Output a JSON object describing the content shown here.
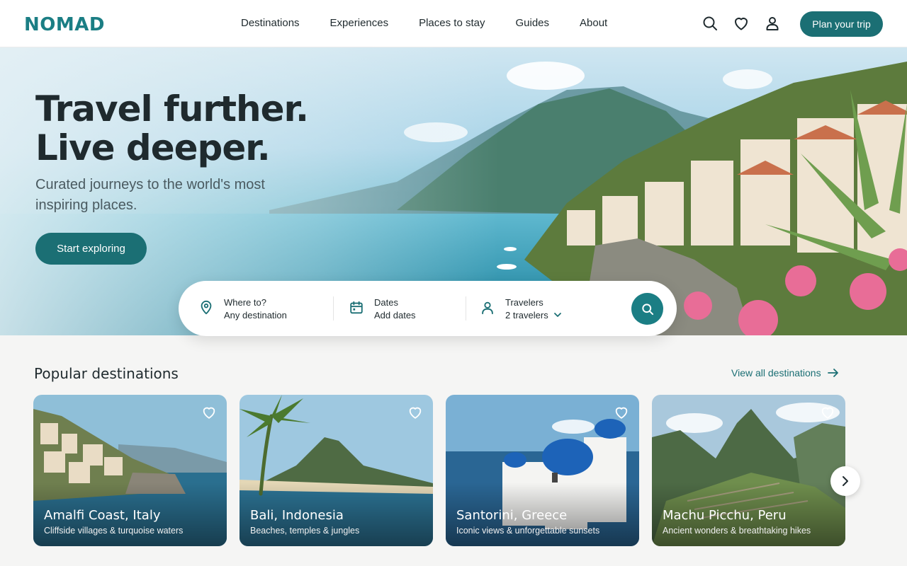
{
  "header": {
    "logo": "NOMAD",
    "nav": [
      "Destinations",
      "Experiences",
      "Places to stay",
      "Guides",
      "About"
    ],
    "icons": [
      "search-icon",
      "heart-icon",
      "user-icon"
    ],
    "cta": "Plan your trip"
  },
  "hero": {
    "title_line1": "Travel further.",
    "title_line2": "Live deeper.",
    "subtitle": "Curated journeys to the world's most inspiring places.",
    "button": "Start exploring"
  },
  "search": {
    "where_label": "Where to?",
    "where_value": "Any destination",
    "dates_label": "Dates",
    "dates_value": "Add dates",
    "travelers_label": "Travelers",
    "travelers_value": "2 travelers"
  },
  "popular": {
    "title": "Popular destinations",
    "view_all": "View all destinations",
    "cards": [
      {
        "name": "Amalfi Coast, Italy",
        "desc": "Cliffside villages & turquoise waters"
      },
      {
        "name": "Bali, Indonesia",
        "desc": "Beaches, temples & jungles"
      },
      {
        "name": "Santorini, Greece",
        "desc": "Iconic views & unforgettable sunsets"
      },
      {
        "name": "Machu Picchu, Peru",
        "desc": "Ancient wonders & breathtaking hikes"
      }
    ]
  },
  "colors": {
    "brand": "#1b7e84",
    "button": "#1b6f74",
    "text": "#1f2a2e"
  }
}
